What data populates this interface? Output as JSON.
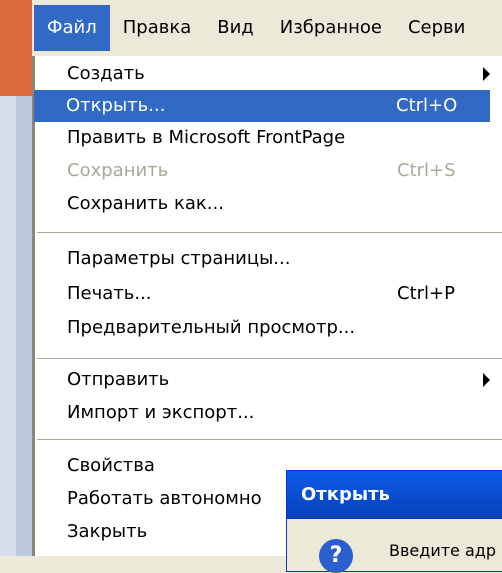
{
  "menubar": {
    "items": [
      "Файл",
      "Правка",
      "Вид",
      "Избранное",
      "Серви"
    ]
  },
  "file_menu": {
    "items": [
      {
        "label": "Создать",
        "shortcut": "",
        "submenu": true
      },
      {
        "label": "Открыть...",
        "shortcut": "Ctrl+O",
        "highlighted": true
      },
      {
        "label": "Править в Microsoft FrontPage",
        "shortcut": ""
      },
      {
        "label": "Сохранить",
        "shortcut": "Ctrl+S",
        "disabled": true
      },
      {
        "label": "Сохранить как...",
        "shortcut": ""
      },
      {
        "label": "Параметры страницы...",
        "shortcut": ""
      },
      {
        "label": "Печать...",
        "shortcut": "Ctrl+P"
      },
      {
        "label": "Предварительный просмотр...",
        "shortcut": ""
      },
      {
        "label": "Отправить",
        "shortcut": "",
        "submenu": true
      },
      {
        "label": "Импорт и экспорт...",
        "shortcut": ""
      },
      {
        "label": "Свойства",
        "shortcut": ""
      },
      {
        "label": "Работать автономно",
        "shortcut": ""
      },
      {
        "label": "Закрыть",
        "shortcut": ""
      }
    ]
  },
  "open_dialog": {
    "title": "Открыть",
    "prompt": "Введите адр",
    "icon": "question-icon"
  },
  "colors": {
    "highlight": "#316ac5",
    "disabled_text": "#aca899",
    "dialog_title": "#0a5ce8"
  }
}
